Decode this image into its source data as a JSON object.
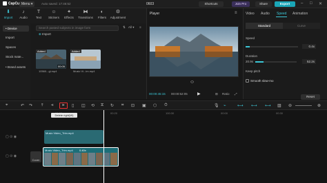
{
  "app": {
    "logo": "CapCut",
    "menu": "Menu",
    "autosave": "Auto saved: 17:46:52",
    "project_title": "0603"
  },
  "titlebar": {
    "shortcuts": "Shortcuts",
    "join_pro": "Join Pro",
    "share": "Share",
    "export": "Export"
  },
  "toolbar": {
    "tools": [
      "Import",
      "Audio",
      "Text",
      "Stickers",
      "Effects",
      "Transitions",
      "Filters",
      "Adjustment"
    ]
  },
  "leftnav": {
    "items": [
      "• Device",
      "Import",
      "Spaces",
      "Stock mate...",
      "• Brand assets"
    ]
  },
  "media": {
    "search_placeholder": "Search pasted subjects in image form",
    "filter_all": "All",
    "import_label": "Import",
    "clips": [
      {
        "added": "Added",
        "duration": "00:05",
        "name": "10560...gi.mp4"
      },
      {
        "added": "Added",
        "duration": "",
        "name": "Music Vi...im.mp4"
      }
    ]
  },
  "player": {
    "label": "Player",
    "current_time": "00:00:45:15",
    "total_time": "00:00:52:05",
    "ratio": "Ratio"
  },
  "props": {
    "tabs": [
      "Video",
      "Audio",
      "Speed",
      "Animation"
    ],
    "speed_modes": [
      "Standard",
      "Curve"
    ],
    "speed_label": "Speed",
    "speed_value": "0.4x",
    "duration_label": "Duration",
    "duration_left": "20.9s",
    "duration_value": "52.2s",
    "keep_pitch": "Keep pitch",
    "smooth_slowmo": "Smooth slow-mo",
    "reset": "Reset",
    "speed_fraction": 0.08,
    "duration_fraction": 0.2
  },
  "timeline": {
    "ruler": [
      "00:00",
      "00:20",
      "100:30",
      "00:00",
      "00:30"
    ],
    "tooltip": "Delete right(W)",
    "clip_top_name": "Music Video_Trim.mp4",
    "clip_main_speed": "0.40x",
    "clip_main_name": "Music Video_Trim.mp4",
    "cover_label": "Cover"
  },
  "colors": {
    "accent": "#3cc8d8",
    "export": "#1aa6b7",
    "clip": "#1c6e78"
  }
}
